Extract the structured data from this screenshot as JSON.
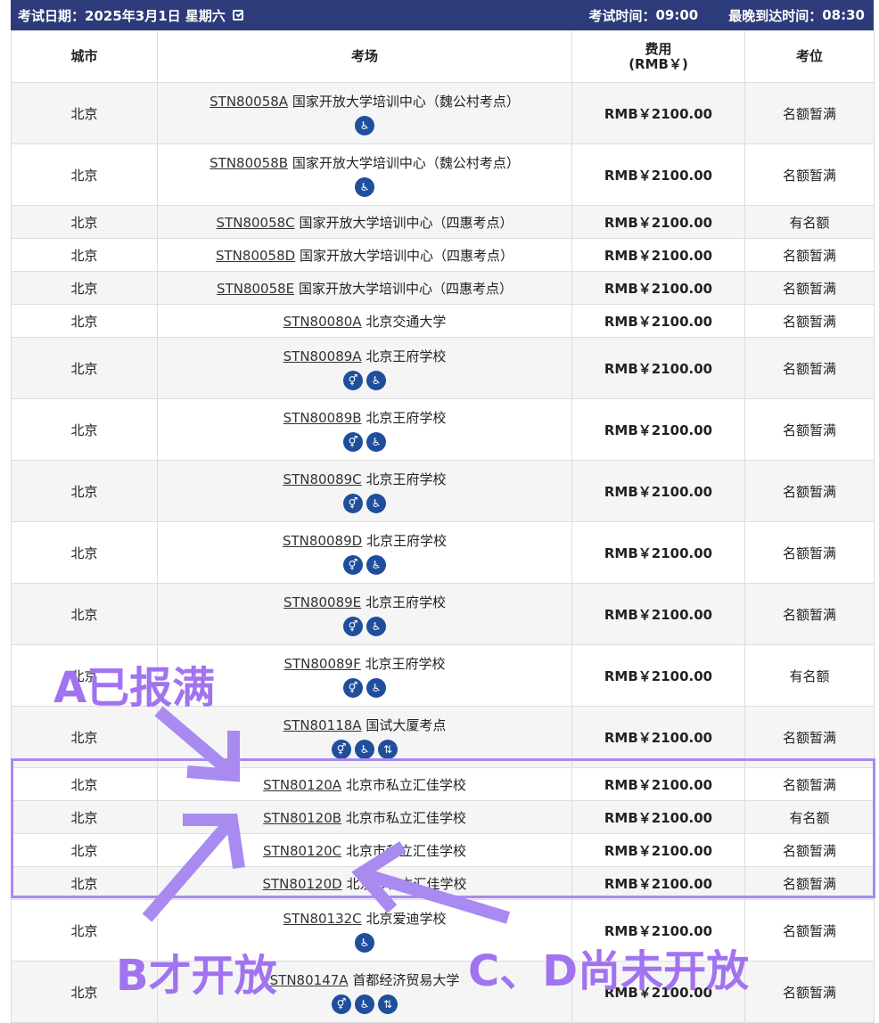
{
  "header": {
    "exam_date_label": "考试日期：",
    "exam_date": "2025年3月1日 星期六",
    "exam_time_label": "考试时间：",
    "exam_time": "09:00",
    "arrival_label": "最晚到达时间：",
    "arrival_time": "08:30"
  },
  "columns": {
    "city": "城市",
    "venue": "考场",
    "fee_line1": "费用",
    "fee_line2": "(RMB￥)",
    "seat": "考位"
  },
  "rows": [
    {
      "city": "北京",
      "code": "STN80058A",
      "name": "国家开放大学培训中心（魏公村考点）",
      "fee": "RMB￥2100.00",
      "seat": "名额暂满",
      "icons": [
        "wheelchair-icon"
      ]
    },
    {
      "city": "北京",
      "code": "STN80058B",
      "name": "国家开放大学培训中心（魏公村考点）",
      "fee": "RMB￥2100.00",
      "seat": "名额暂满",
      "icons": [
        "wheelchair-icon"
      ]
    },
    {
      "city": "北京",
      "code": "STN80058C",
      "name": "国家开放大学培训中心（四惠考点）",
      "fee": "RMB￥2100.00",
      "seat": "有名额",
      "icons": []
    },
    {
      "city": "北京",
      "code": "STN80058D",
      "name": "国家开放大学培训中心（四惠考点）",
      "fee": "RMB￥2100.00",
      "seat": "名额暂满",
      "icons": []
    },
    {
      "city": "北京",
      "code": "STN80058E",
      "name": "国家开放大学培训中心（四惠考点）",
      "fee": "RMB￥2100.00",
      "seat": "名额暂满",
      "icons": []
    },
    {
      "city": "北京",
      "code": "STN80080A",
      "name": "北京交通大学",
      "fee": "RMB￥2100.00",
      "seat": "名额暂满",
      "icons": []
    },
    {
      "city": "北京",
      "code": "STN80089A",
      "name": "北京王府学校",
      "fee": "RMB￥2100.00",
      "seat": "名额暂满",
      "icons": [
        "restroom-icon",
        "wheelchair-icon"
      ]
    },
    {
      "city": "北京",
      "code": "STN80089B",
      "name": "北京王府学校",
      "fee": "RMB￥2100.00",
      "seat": "名额暂满",
      "icons": [
        "restroom-icon",
        "wheelchair-icon"
      ]
    },
    {
      "city": "北京",
      "code": "STN80089C",
      "name": "北京王府学校",
      "fee": "RMB￥2100.00",
      "seat": "名额暂满",
      "icons": [
        "restroom-icon",
        "wheelchair-icon"
      ]
    },
    {
      "city": "北京",
      "code": "STN80089D",
      "name": "北京王府学校",
      "fee": "RMB￥2100.00",
      "seat": "名额暂满",
      "icons": [
        "restroom-icon",
        "wheelchair-icon"
      ]
    },
    {
      "city": "北京",
      "code": "STN80089E",
      "name": "北京王府学校",
      "fee": "RMB￥2100.00",
      "seat": "名额暂满",
      "icons": [
        "restroom-icon",
        "wheelchair-icon"
      ]
    },
    {
      "city": "北京",
      "code": "STN80089F",
      "name": "北京王府学校",
      "fee": "RMB￥2100.00",
      "seat": "有名额",
      "icons": [
        "restroom-icon",
        "wheelchair-icon"
      ]
    },
    {
      "city": "北京",
      "code": "STN80118A",
      "name": "国试大厦考点",
      "fee": "RMB￥2100.00",
      "seat": "名额暂满",
      "icons": [
        "restroom-icon",
        "wheelchair-icon",
        "elevator-icon"
      ]
    },
    {
      "city": "北京",
      "code": "STN80120A",
      "name": "北京市私立汇佳学校",
      "fee": "RMB￥2100.00",
      "seat": "名额暂满",
      "icons": []
    },
    {
      "city": "北京",
      "code": "STN80120B",
      "name": "北京市私立汇佳学校",
      "fee": "RMB￥2100.00",
      "seat": "有名额",
      "icons": []
    },
    {
      "city": "北京",
      "code": "STN80120C",
      "name": "北京市私立汇佳学校",
      "fee": "RMB￥2100.00",
      "seat": "名额暂满",
      "icons": []
    },
    {
      "city": "北京",
      "code": "STN80120D",
      "name": "北京市私立汇佳学校",
      "fee": "RMB￥2100.00",
      "seat": "名额暂满",
      "icons": []
    },
    {
      "city": "北京",
      "code": "STN80132C",
      "name": "北京爱迪学校",
      "fee": "RMB￥2100.00",
      "seat": "名额暂满",
      "icons": [
        "wheelchair-icon"
      ]
    },
    {
      "city": "北京",
      "code": "STN80147A",
      "name": "首都经济贸易大学",
      "fee": "RMB￥2100.00",
      "seat": "名额暂满",
      "icons": [
        "restroom-icon",
        "wheelchair-icon",
        "elevator-icon"
      ]
    }
  ],
  "annotations": {
    "a": "A已报满",
    "b": "B才开放",
    "cd": "C、D尚未开放",
    "color": "#a173f0"
  },
  "colors": {
    "header_bg": "#2e3b7a",
    "icon_bg": "#1f4f9c"
  }
}
